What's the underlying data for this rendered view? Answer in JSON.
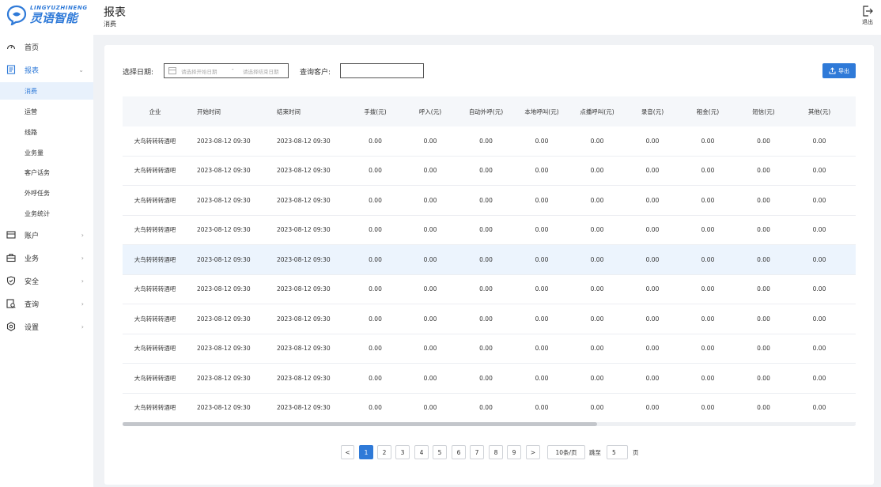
{
  "brand": {
    "logo_en": "LINGYUZHINENG",
    "logo_cn": "灵语智能"
  },
  "header": {
    "title": "报表",
    "subtitle": "消费",
    "logout_label": "退出"
  },
  "sidebar": {
    "items": [
      {
        "label": "首页",
        "icon": "dashboard-icon",
        "arrow": ""
      },
      {
        "label": "报表",
        "icon": "report-icon",
        "arrow": "⌄"
      },
      {
        "label": "账户",
        "icon": "account-icon",
        "arrow": "›"
      },
      {
        "label": "业务",
        "icon": "briefcase-icon",
        "arrow": "›"
      },
      {
        "label": "安全",
        "icon": "shield-icon",
        "arrow": "›"
      },
      {
        "label": "查询",
        "icon": "query-icon",
        "arrow": "›"
      },
      {
        "label": "设置",
        "icon": "gear-icon",
        "arrow": "›"
      }
    ],
    "subitems": [
      "消费",
      "运营",
      "线路",
      "业务量",
      "客户话务",
      "外呼任务",
      "业务统计"
    ]
  },
  "filters": {
    "date_label": "选择日期:",
    "start_placeholder": "请选择开始日期",
    "separator": "-",
    "end_placeholder": "请选择结束日期",
    "customer_label": "查询客户:",
    "customer_value": "",
    "export_label": "导出"
  },
  "table": {
    "columns": [
      "企业",
      "开始时间",
      "结束时间",
      "手拨(元)",
      "呼入(元)",
      "自动外呼(元)",
      "本地呼叫(元)",
      "点播呼叫(元)",
      "录音(元)",
      "租金(元)",
      "短信(元)",
      "其他(元)"
    ],
    "rows": [
      [
        "大鸟转转转酒吧",
        "2023-08-12 09:30",
        "2023-08-12 09:30",
        "0.00",
        "0.00",
        "0.00",
        "0.00",
        "0.00",
        "0.00",
        "0.00",
        "0.00",
        "0.00"
      ],
      [
        "大鸟转转转酒吧",
        "2023-08-12 09:30",
        "2023-08-12 09:30",
        "0.00",
        "0.00",
        "0.00",
        "0.00",
        "0.00",
        "0.00",
        "0.00",
        "0.00",
        "0.00"
      ],
      [
        "大鸟转转转酒吧",
        "2023-08-12 09:30",
        "2023-08-12 09:30",
        "0.00",
        "0.00",
        "0.00",
        "0.00",
        "0.00",
        "0.00",
        "0.00",
        "0.00",
        "0.00"
      ],
      [
        "大鸟转转转酒吧",
        "2023-08-12 09:30",
        "2023-08-12 09:30",
        "0.00",
        "0.00",
        "0.00",
        "0.00",
        "0.00",
        "0.00",
        "0.00",
        "0.00",
        "0.00"
      ],
      [
        "大鸟转转转酒吧",
        "2023-08-12 09:30",
        "2023-08-12 09:30",
        "0.00",
        "0.00",
        "0.00",
        "0.00",
        "0.00",
        "0.00",
        "0.00",
        "0.00",
        "0.00"
      ],
      [
        "大鸟转转转酒吧",
        "2023-08-12 09:30",
        "2023-08-12 09:30",
        "0.00",
        "0.00",
        "0.00",
        "0.00",
        "0.00",
        "0.00",
        "0.00",
        "0.00",
        "0.00"
      ],
      [
        "大鸟转转转酒吧",
        "2023-08-12 09:30",
        "2023-08-12 09:30",
        "0.00",
        "0.00",
        "0.00",
        "0.00",
        "0.00",
        "0.00",
        "0.00",
        "0.00",
        "0.00"
      ],
      [
        "大鸟转转转酒吧",
        "2023-08-12 09:30",
        "2023-08-12 09:30",
        "0.00",
        "0.00",
        "0.00",
        "0.00",
        "0.00",
        "0.00",
        "0.00",
        "0.00",
        "0.00"
      ],
      [
        "大鸟转转转酒吧",
        "2023-08-12 09:30",
        "2023-08-12 09:30",
        "0.00",
        "0.00",
        "0.00",
        "0.00",
        "0.00",
        "0.00",
        "0.00",
        "0.00",
        "0.00"
      ],
      [
        "大鸟转转转酒吧",
        "2023-08-12 09:30",
        "2023-08-12 09:30",
        "0.00",
        "0.00",
        "0.00",
        "0.00",
        "0.00",
        "0.00",
        "0.00",
        "0.00",
        "0.00"
      ]
    ],
    "highlighted_row": 4
  },
  "pagination": {
    "prev": "<",
    "next": ">",
    "pages": [
      "1",
      "2",
      "3",
      "4",
      "5",
      "6",
      "7",
      "8",
      "9"
    ],
    "current": "1",
    "page_size": "10条/页",
    "jump_label": "跳至",
    "jump_value": "5",
    "page_suffix": "页"
  },
  "colors": {
    "accent": "#2f7ad8",
    "highlight_row": "#ecf4fd"
  }
}
